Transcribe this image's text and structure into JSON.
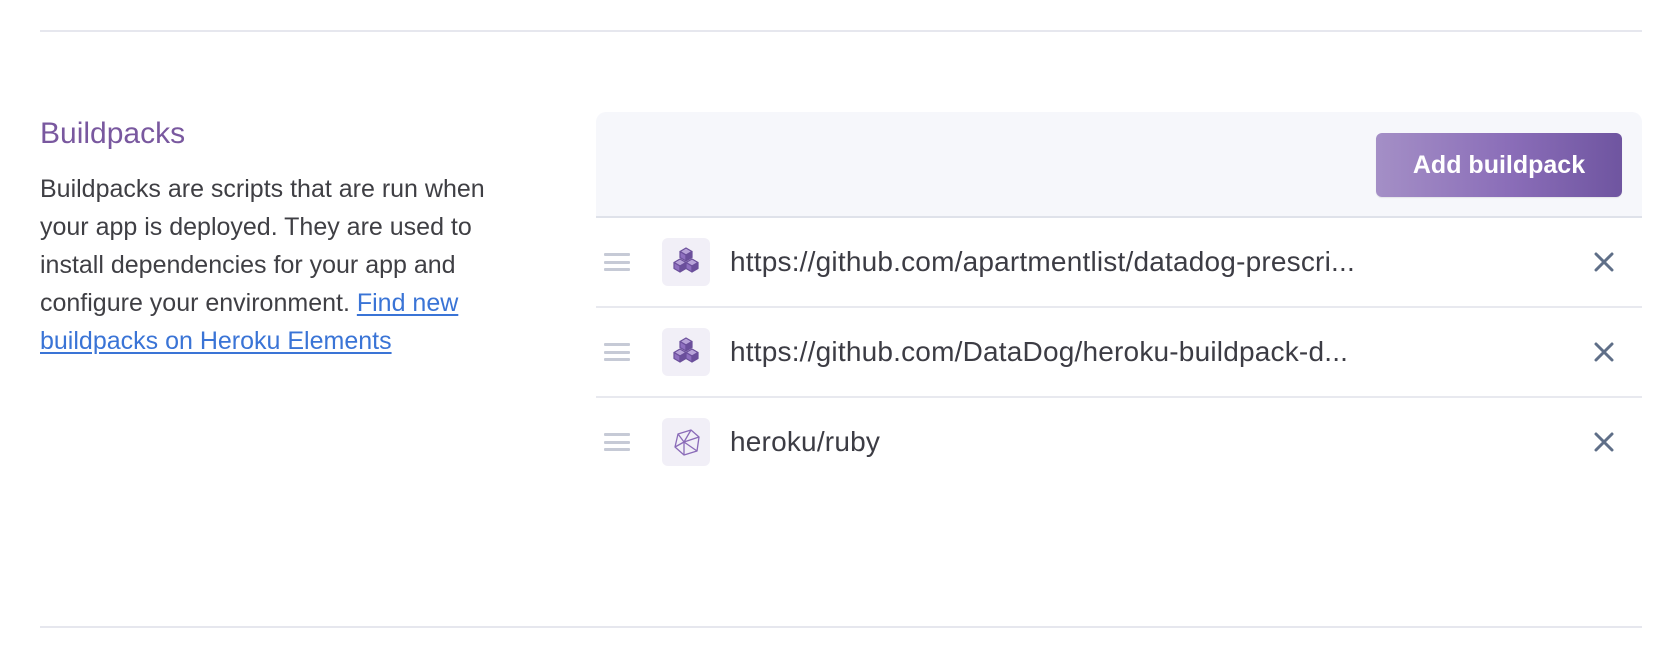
{
  "section": {
    "title": "Buildpacks",
    "description": "Buildpacks are scripts that are run when your app is deployed. They are used to install dependencies for your app and configure your environment.",
    "link_text": "Find new buildpacks on Heroku Elements"
  },
  "panel": {
    "add_button_label": "Add buildpack"
  },
  "buildpacks": [
    {
      "url": "https://github.com/apartmentlist/datadog-prescri...",
      "icon": "cubes-icon"
    },
    {
      "url": "https://github.com/DataDog/heroku-buildpack-d...",
      "icon": "cubes-icon"
    },
    {
      "url": "heroku/ruby",
      "icon": "ruby-icon"
    }
  ],
  "colors": {
    "title_purple": "#79589f",
    "link_blue": "#3a74d6",
    "button_gradient_start": "#a48fc6",
    "button_gradient_end": "#6f55a0",
    "panel_header_bg": "#f6f7fb",
    "icon_bg": "#f1eff7",
    "remove_icon": "#5f6f88"
  }
}
